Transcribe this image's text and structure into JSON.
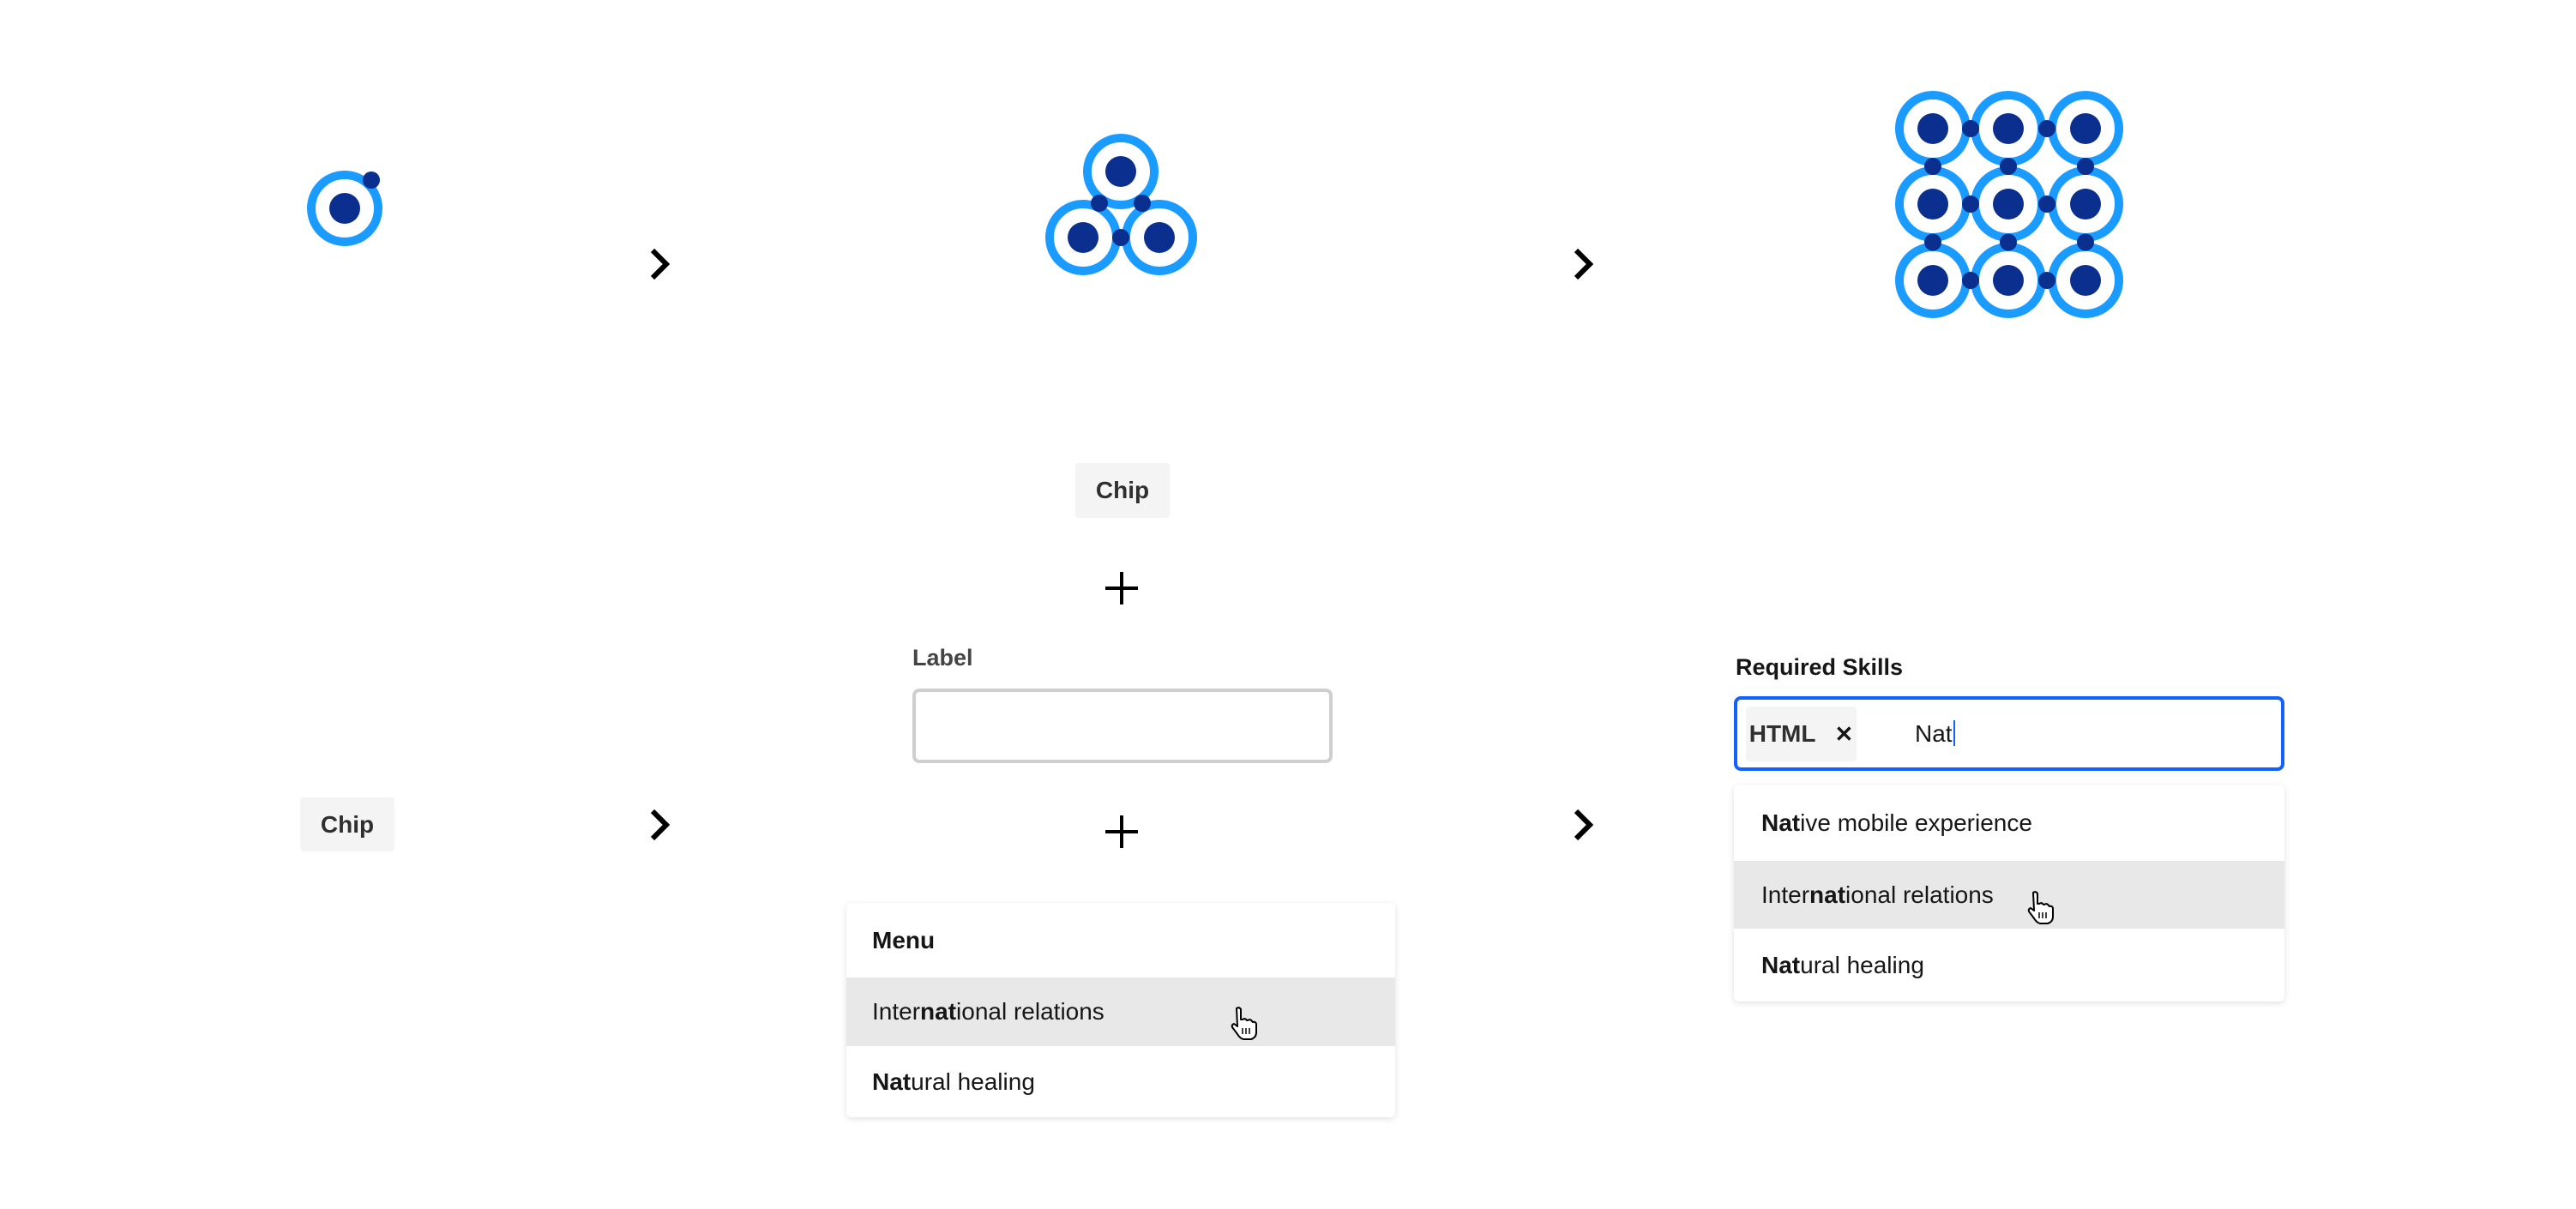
{
  "colors": {
    "ring": "#1a9bff",
    "core": "#0a2f8f",
    "focus_border": "#0f62fe",
    "chip_bg": "#f4f4f4",
    "hover_bg": "#e8e8e8"
  },
  "row1": {
    "stage1_icon": "single-atom-icon",
    "stage2_icon": "three-atom-cluster-icon",
    "stage3_icon": "atom-grid-3x3-icon",
    "arrow_icon": "chevron-right-icon"
  },
  "row2": {
    "left_chip": "Chip",
    "middle": {
      "chip": "Chip",
      "plus_icon": "plus-icon",
      "label": "Label",
      "input_value": "",
      "menu": {
        "header": "Menu",
        "items": [
          {
            "pre": "Inter",
            "match": "nat",
            "post": "ional relations",
            "hovered": true
          },
          {
            "pre": "",
            "match": "Nat",
            "post": "ural healing",
            "hovered": false
          }
        ]
      }
    },
    "right": {
      "label": "Required Skills",
      "tag": "HTML",
      "tag_remove": "✕",
      "typed": "Nat",
      "options": [
        {
          "pre": "",
          "match": "Nat",
          "post": "ive mobile experience",
          "hovered": false
        },
        {
          "pre": "Inter",
          "match": "nat",
          "post": "ional relations",
          "hovered": true
        },
        {
          "pre": "",
          "match": "Nat",
          "post": "ural healing",
          "hovered": false
        }
      ]
    }
  }
}
